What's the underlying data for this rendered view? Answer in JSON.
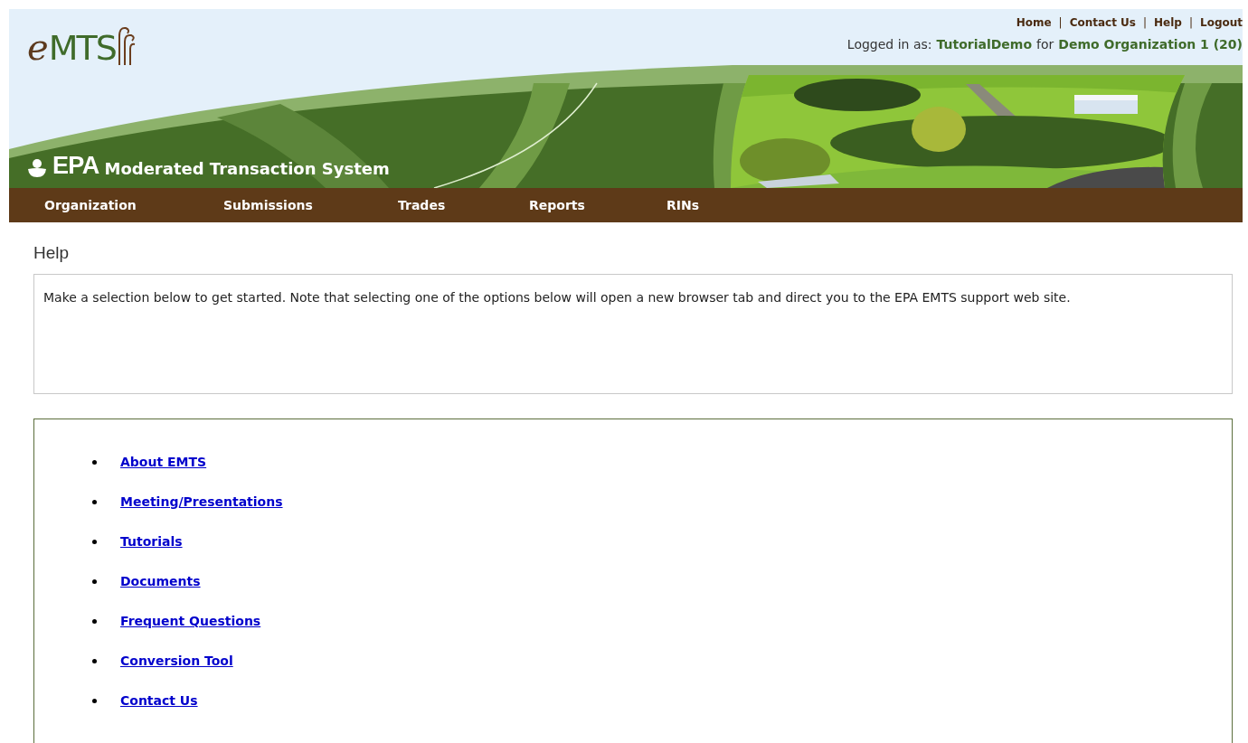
{
  "header": {
    "logo": {
      "prefix": "e",
      "name": "MTS"
    },
    "agency": "EPA",
    "system_title": "Moderated Transaction System",
    "top_links": [
      "Home",
      "Contact Us",
      "Help",
      "Logout"
    ],
    "link_separator": "|",
    "login": {
      "label": "Logged in as:",
      "user": "TutorialDemo",
      "connector": "for",
      "organization": "Demo Organization 1 (20)"
    }
  },
  "nav": [
    {
      "label": "Organization"
    },
    {
      "label": "Submissions"
    },
    {
      "label": "Trades"
    },
    {
      "label": "Reports"
    },
    {
      "label": "RINs"
    }
  ],
  "page_title": "Help",
  "intro": "Make a selection below to get started. Note that selecting one of the options below will open a new browser tab and direct you to the EPA EMTS support web site.",
  "help_links": [
    "About EMTS",
    "Meeting/Presentations",
    "Tutorials",
    "Documents",
    "Frequent Questions",
    "Conversion Tool",
    "Contact Us"
  ]
}
